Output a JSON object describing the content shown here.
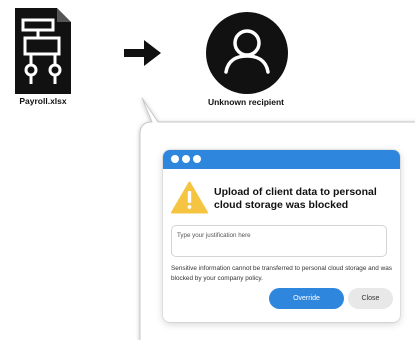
{
  "flow": {
    "source_file": {
      "label": "Payroll.xlsx",
      "icon": "spreadsheet-file-icon"
    },
    "arrow_icon": "right-arrow-icon",
    "recipient": {
      "label": "Unknown recipient",
      "icon": "user-avatar-icon"
    }
  },
  "dialog": {
    "titlebar_color": "#2f86dd",
    "titlebar_dots": 3,
    "warning_icon": "warning-triangle-icon",
    "warning_color": "#f5c542",
    "title": "Upload of client data to personal cloud storage was blocked",
    "justification": {
      "value": "",
      "placeholder": "Type your justification here"
    },
    "message": "Sensitive information cannot be transferred to personal cloud storage and was blocked by your company policy.",
    "buttons": {
      "override_label": "Override",
      "close_label": "Close"
    },
    "accent_color": "#2f86dd"
  }
}
